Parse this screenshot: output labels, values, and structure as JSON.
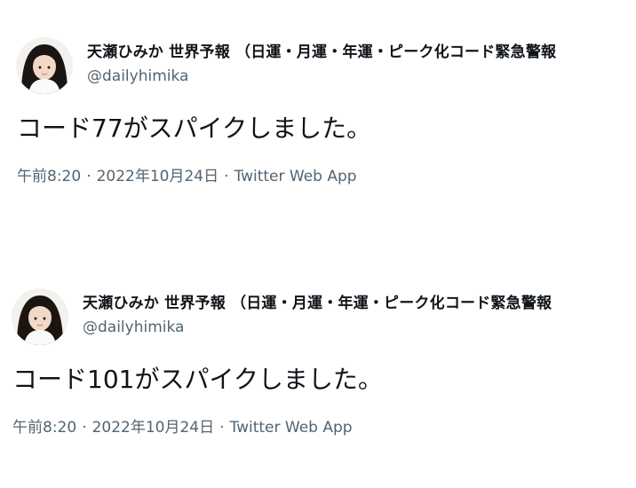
{
  "separator": "·",
  "tweets": [
    {
      "display_name": "天瀬ひみか 世界予報 （日運・月運・年運・ピーク化コード緊急警報",
      "handle": "@dailyhimika",
      "text": "コード77がスパイクしました。",
      "time": "午前8:20",
      "date": "2022年10月24日",
      "source": "Twitter Web App"
    },
    {
      "display_name": "天瀬ひみか 世界予報 （日運・月運・年運・ピーク化コード緊急警報",
      "handle": "@dailyhimika",
      "text": "コード101がスパイクしました。",
      "time": "午前8:20",
      "date": "2022年10月24日",
      "source": "Twitter Web App"
    }
  ],
  "colors": {
    "text_primary": "#0f1419",
    "text_secondary": "#536471",
    "background": "#ffffff"
  }
}
